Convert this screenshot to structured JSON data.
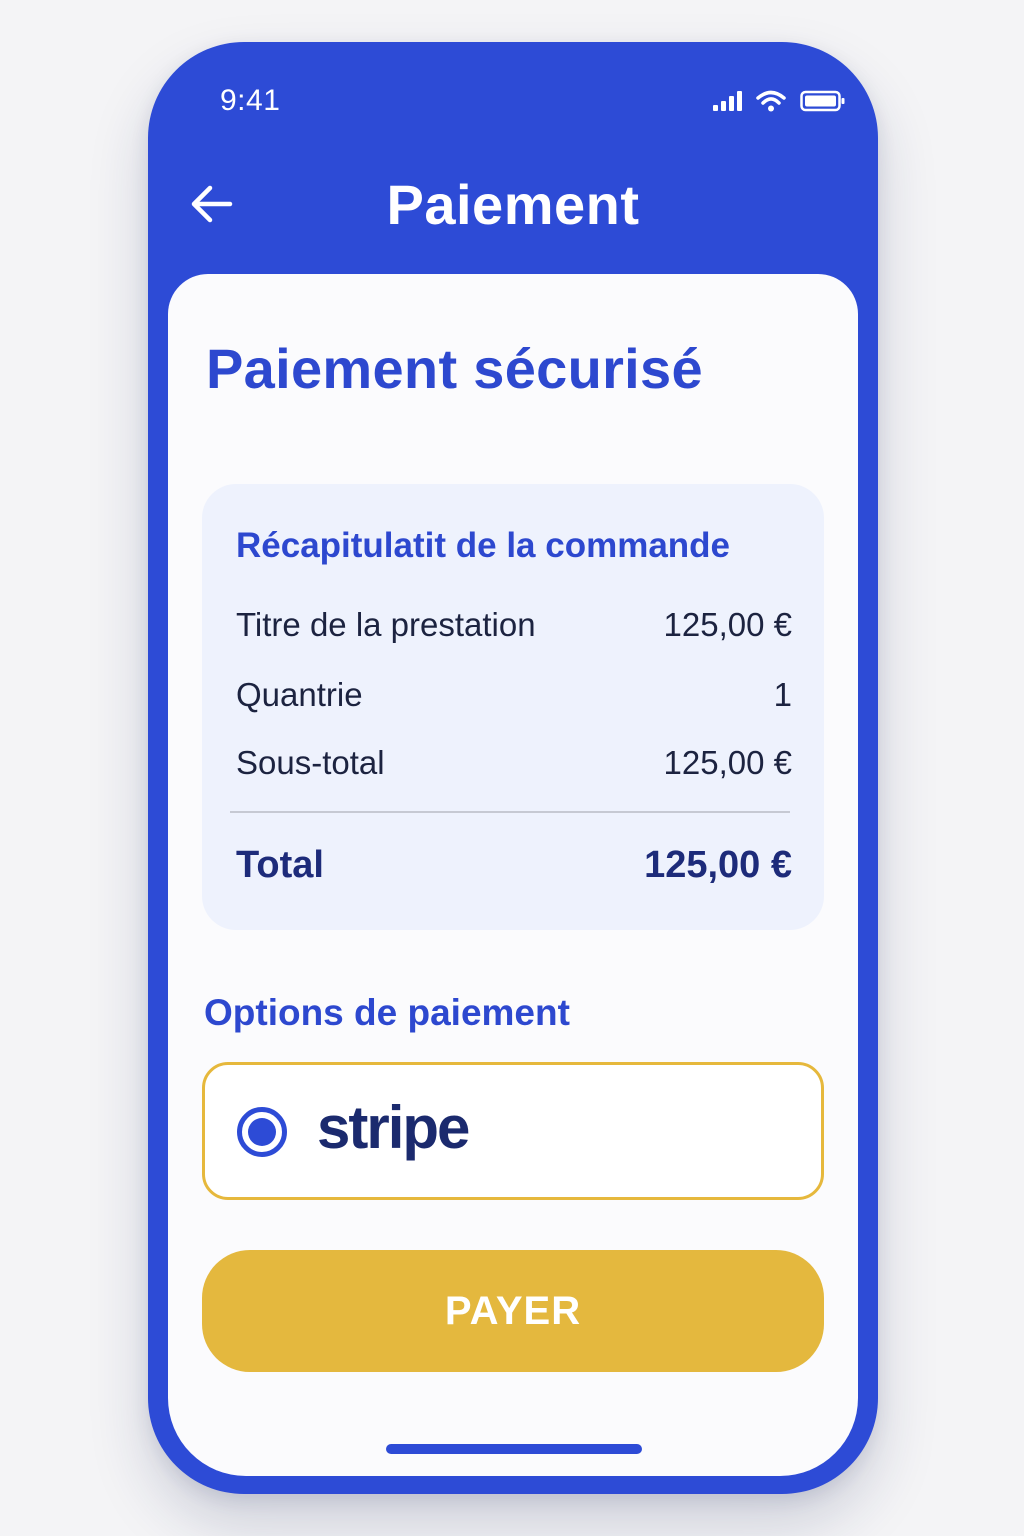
{
  "status_bar": {
    "time": "9:41",
    "icons": [
      "signal-icon",
      "wifi-icon",
      "battery-icon"
    ]
  },
  "nav": {
    "back_icon": "arrow-left-icon",
    "title": "Paiement"
  },
  "main": {
    "heading": "Paiement sécurisé",
    "summary": {
      "title": "Récapitulatit de la commande",
      "rows": [
        {
          "label": "Titre de la prestation",
          "value": "125,00 €"
        },
        {
          "label": "Quantrie",
          "value": "1"
        },
        {
          "label": "Sous-total",
          "value": "125,00 €"
        }
      ],
      "total_label": "Total",
      "total_value": "125,00 €"
    },
    "payment_options": {
      "heading": "Options de paiement",
      "options": [
        {
          "label": "stripe",
          "selected": true
        }
      ]
    },
    "pay_button_label": "PAYER"
  },
  "colors": {
    "primary": "#2d4bd6",
    "accent": "#e4b83e",
    "summary_bg": "#eef2fd",
    "total_text": "#1d2b7a"
  }
}
